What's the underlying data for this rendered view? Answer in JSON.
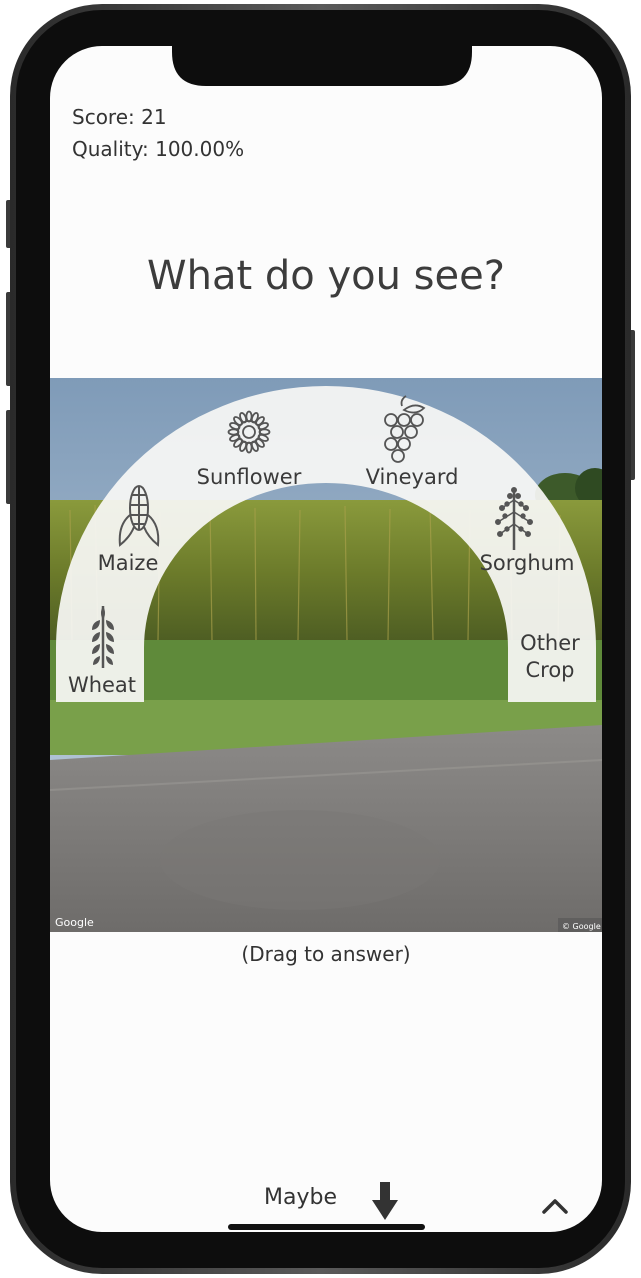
{
  "header": {
    "score_text": "Score: 21",
    "quality_text": "Quality: 100.00%"
  },
  "question": {
    "title": "What do you see?"
  },
  "options": {
    "wheat": "Wheat",
    "maize": "Maize",
    "sunflower": "Sunflower",
    "vineyard": "Vineyard",
    "sorghum": "Sorghum",
    "other_line1": "Other",
    "other_line2": "Crop"
  },
  "photo": {
    "watermark_left": "Google",
    "watermark_right": "© Google"
  },
  "instructions": {
    "hint": "(Drag to answer)"
  },
  "footer": {
    "maybe_label": "Maybe"
  },
  "icons": [
    "wheat-icon",
    "maize-icon",
    "sunflower-icon",
    "grapes-icon",
    "sorghum-icon",
    "arrow-down-icon",
    "chevron-up-icon"
  ]
}
